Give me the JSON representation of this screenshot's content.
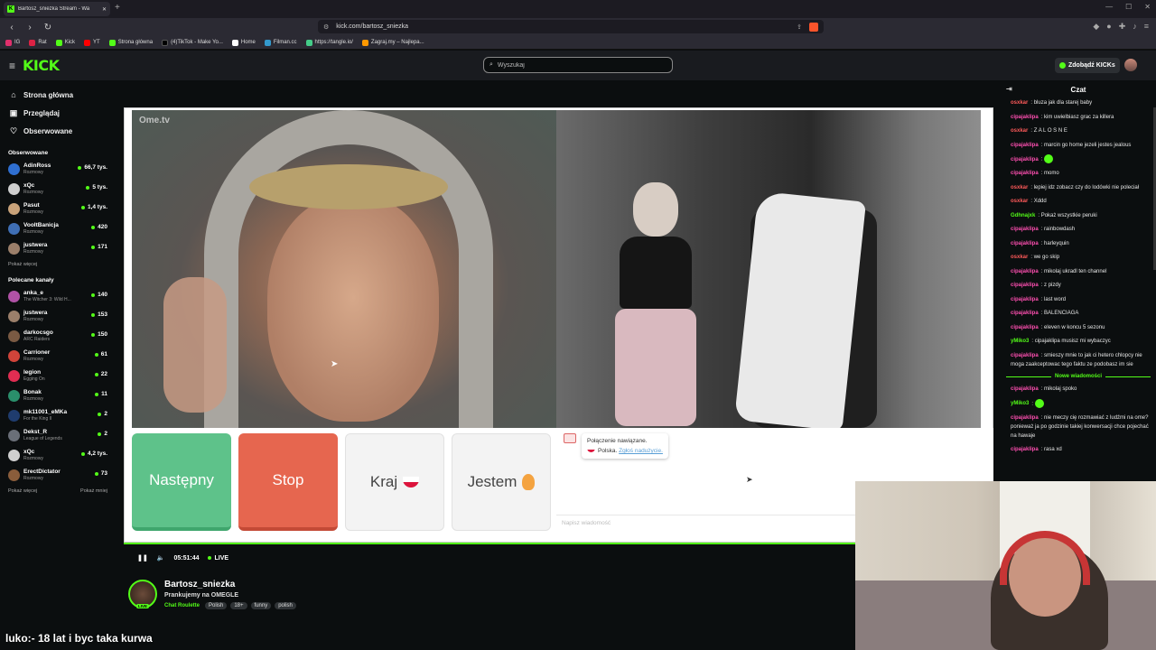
{
  "browser": {
    "tab_title": "Bartosz_sniezka Stream - Wa",
    "url": "kick.com/bartosz_sniezka",
    "bookmarks": [
      "IG",
      "Rat",
      "Kick",
      "YT",
      "Strona główna",
      "(4)TikTok - Make Yo...",
      "Home",
      "Filman.cc",
      "https://tangle.io/",
      "Zagraj.my – Najlepa..."
    ]
  },
  "header": {
    "search_placeholder": "Wyszukaj",
    "kicks_button": "Zdobądź KICKs"
  },
  "sidebar": {
    "nav": [
      "Strona główna",
      "Przeglądaj",
      "Obserwowane"
    ],
    "followed_title": "Obserwowane",
    "followed": [
      {
        "name": "AdinRoss",
        "game": "Rozmowy",
        "viewers": "66,7 tys.",
        "color": "#2f6fd1"
      },
      {
        "name": "xQc",
        "game": "Rozmowy",
        "viewers": "5 tys.",
        "color": "#cfcfcf"
      },
      {
        "name": "Pasut",
        "game": "Rozmowy",
        "viewers": "1,4 tys.",
        "color": "#c9a37a"
      },
      {
        "name": "VooltBanicja",
        "game": "Rozmowy",
        "viewers": "420",
        "color": "#3f6fb5"
      },
      {
        "name": "justwera",
        "game": "Rozmowy",
        "viewers": "171",
        "color": "#9b7f6a"
      }
    ],
    "followed_more": "Pokaż więcej",
    "recommended_title": "Polecane kanały",
    "recommended": [
      {
        "name": "anka_e",
        "game": "The Witcher 3: Wild H...",
        "viewers": "140",
        "color": "#b052a6"
      },
      {
        "name": "justwera",
        "game": "Rozmowy",
        "viewers": "153",
        "color": "#9b7f6a"
      },
      {
        "name": "darkocsgo",
        "game": "ARC Raiders",
        "viewers": "150",
        "color": "#7a5a43"
      },
      {
        "name": "Carrioner",
        "game": "Rozmowy",
        "viewers": "61",
        "color": "#d0443a"
      },
      {
        "name": "legion",
        "game": "Egging On",
        "viewers": "22",
        "color": "#e02d52"
      },
      {
        "name": "Bonak",
        "game": "Rozmowy",
        "viewers": "11",
        "color": "#2a8f6b"
      },
      {
        "name": "mk11001_eMKa",
        "game": "For the King II",
        "viewers": "2",
        "color": "#1f3c6e"
      },
      {
        "name": "Dekst_R",
        "game": "League of Legends",
        "viewers": "2",
        "color": "#6a6f78"
      },
      {
        "name": "xQc",
        "game": "Rozmowy",
        "viewers": "4,2 tys.",
        "color": "#cfcfcf"
      },
      {
        "name": "ErectDictator",
        "game": "Rozmowy",
        "viewers": "73",
        "color": "#8a5d3b"
      }
    ],
    "rec_more": "Pokaż więcej",
    "rec_less": "Pokaż mniej"
  },
  "omegle": {
    "logo": "Ome.tv",
    "btn_next": "Następny",
    "btn_stop": "Stop",
    "btn_country": "Kraj",
    "btn_iam": "Jestem",
    "connected": "Połączenie nawiązane.",
    "country": "Polska.",
    "report": "Zgłoś nadużycie.",
    "input_placeholder": "Napisz wiadomość"
  },
  "player": {
    "time": "05:51:44",
    "live": "LIVE"
  },
  "stream": {
    "streamer": "Bartosz_sniezka",
    "title": "Prankujemy na OMEGLE",
    "category": "Chat Roulette",
    "tags": [
      "Polish",
      "18+",
      "funny",
      "polish"
    ],
    "live_badge": "LIVE"
  },
  "caption": "luko:- 18 lat i byc taka kurwa",
  "chat": {
    "title": "Czat",
    "messages": [
      {
        "user": "osxkar",
        "text": "bluza jak dla starej baby",
        "cls": "u-os"
      },
      {
        "user": "cipajaklipa",
        "text": "kim uwielbiasz grac za killera",
        "cls": "u-ci"
      },
      {
        "user": "osxkar",
        "text": "Z A L O S N E",
        "cls": "u-os"
      },
      {
        "user": "cipajaklipa",
        "text": "marcin go home jezeli jestes jealous",
        "cls": "u-ci"
      },
      {
        "user": "cipajaklipa",
        "text": "",
        "cls": "u-ci",
        "emote": true
      },
      {
        "user": "cipajaklipa",
        "text": "momo",
        "cls": "u-ci"
      },
      {
        "user": "osxkar",
        "text": "lepiej idz zobacz czy do lodówki nie poleciał",
        "cls": "u-os"
      },
      {
        "user": "osxkar",
        "text": "Xddd",
        "cls": "u-os"
      },
      {
        "user": "Gdhnajxk",
        "text": "Pokaż wszystkie peruki",
        "cls": "u-gd"
      },
      {
        "user": "cipajaklipa",
        "text": "rainbowdash",
        "cls": "u-ci"
      },
      {
        "user": "cipajaklipa",
        "text": "harleyquin",
        "cls": "u-ci"
      },
      {
        "user": "osxkar",
        "text": "we go skip",
        "cls": "u-os"
      },
      {
        "user": "cipajaklipa",
        "text": "mikolaj ukradl ten channel",
        "cls": "u-ci"
      },
      {
        "user": "cipajaklipa",
        "text": "z pizdy",
        "cls": "u-ci"
      },
      {
        "user": "cipajaklipa",
        "text": "last word",
        "cls": "u-ci"
      },
      {
        "user": "cipajaklipa",
        "text": "BALENCIAGA",
        "cls": "u-ci"
      },
      {
        "user": "cipajaklipa",
        "text": "eleven w koncu 5 sezonu",
        "cls": "u-ci"
      },
      {
        "user": "yMiko3",
        "text": "cipajaklipa musisz mi wybaczyc",
        "cls": "u-ym"
      },
      {
        "user": "cipajaklipa",
        "text": "smieszy mnie to jak ci hetero chlopcy nie moga zaakceptowac tego faktu ze podobasz im sie",
        "cls": "u-ci"
      }
    ],
    "new_label": "Nowe wiadomości",
    "new_messages": [
      {
        "user": "cipajaklipa",
        "text": "mikolaj spoko",
        "cls": "u-ci"
      },
      {
        "user": "yMiko3",
        "text": "",
        "cls": "u-ym",
        "emote": true
      },
      {
        "user": "cipajaklipa",
        "text": "nie meczy cię rozmawiać z ludźmi na ome? ponieważ ja po godzinie takiej konwersacji chce pojechać na hawaje",
        "cls": "u-ci"
      },
      {
        "user": "cipajaklipa",
        "text": "rasa xd",
        "cls": "u-ci"
      }
    ]
  }
}
